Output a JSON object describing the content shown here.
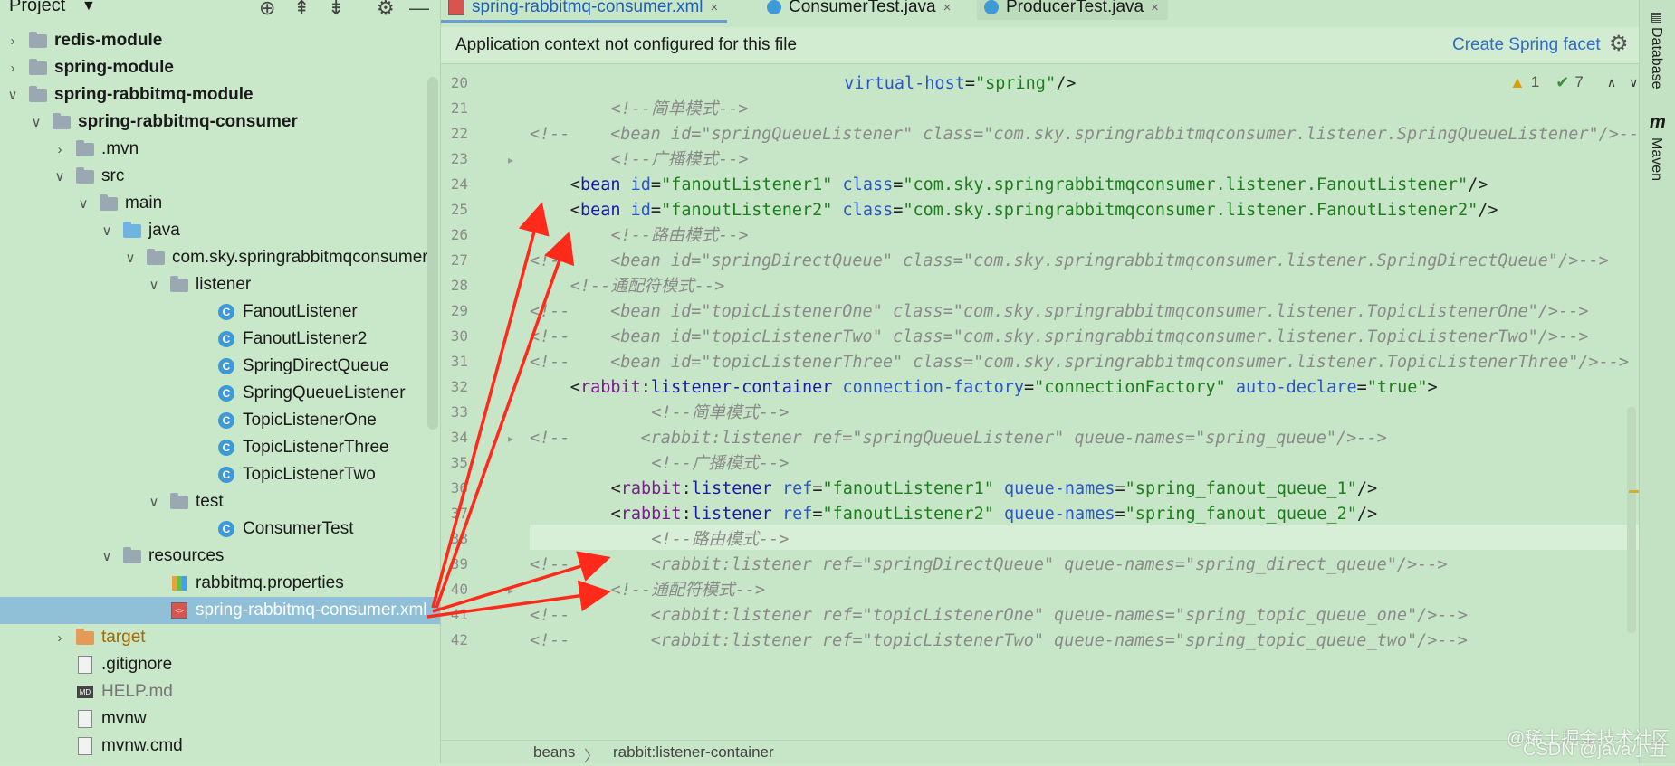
{
  "project_panel": {
    "title": "Project",
    "tree": [
      {
        "label": "redis-module",
        "bold": true,
        "icon": "module-folder",
        "chev": "right"
      },
      {
        "label": "spring-module",
        "bold": true,
        "icon": "module-folder",
        "chev": "right"
      },
      {
        "label": "spring-rabbitmq-module",
        "bold": true,
        "icon": "module-folder",
        "chev": "down"
      },
      {
        "label": "spring-rabbitmq-consumer",
        "bold": true,
        "icon": "module-folder",
        "chev": "down"
      },
      {
        "label": ".mvn",
        "icon": "folder",
        "chev": "right"
      },
      {
        "label": "src",
        "icon": "folder",
        "chev": "down"
      },
      {
        "label": "main",
        "icon": "folder",
        "chev": "down"
      },
      {
        "label": "java",
        "icon": "source-folder",
        "chev": "down"
      },
      {
        "label": "com.sky.springrabbitmqconsumer",
        "icon": "package",
        "chev": "down"
      },
      {
        "label": "listener",
        "icon": "package",
        "chev": "down"
      },
      {
        "label": "FanoutListener",
        "icon": "class"
      },
      {
        "label": "FanoutListener2",
        "icon": "class"
      },
      {
        "label": "SpringDirectQueue",
        "icon": "class"
      },
      {
        "label": "SpringQueueListener",
        "icon": "class"
      },
      {
        "label": "TopicListenerOne",
        "icon": "class"
      },
      {
        "label": "TopicListenerThree",
        "icon": "class"
      },
      {
        "label": "TopicListenerTwo",
        "icon": "class"
      },
      {
        "label": "test",
        "icon": "package",
        "chev": "down"
      },
      {
        "label": "ConsumerTest",
        "icon": "test-class"
      },
      {
        "label": "resources",
        "icon": "resources-folder",
        "chev": "down"
      },
      {
        "label": "rabbitmq.properties",
        "icon": "properties"
      },
      {
        "label": "spring-rabbitmq-consumer.xml",
        "icon": "xml",
        "selected": true
      },
      {
        "label": "target",
        "icon": "target-folder",
        "chev": "right"
      },
      {
        "label": ".gitignore",
        "icon": "file"
      },
      {
        "label": "HELP.md",
        "icon": "markdown"
      },
      {
        "label": "mvnw",
        "icon": "file"
      },
      {
        "label": "mvnw.cmd",
        "icon": "file"
      }
    ]
  },
  "tabs": [
    {
      "label": "spring-rabbitmq-consumer.xml",
      "active": true,
      "icon": "xml"
    },
    {
      "label": "ConsumerTest.java",
      "active": false,
      "icon": "class"
    },
    {
      "label": "ProducerTest.java",
      "active": false,
      "icon": "class"
    }
  ],
  "banner": {
    "text": "Application context not configured for this file",
    "action": "Create Spring facet"
  },
  "inspections": {
    "warnings": "1",
    "weak_warnings": "7"
  },
  "code_lines": [
    {
      "n": "20",
      "indent": 31,
      "parts": [
        [
          "at",
          "virtual-host"
        ],
        [
          "pl",
          "="
        ],
        [
          "st",
          "\"spring\""
        ],
        [
          "pl",
          "/>"
        ]
      ]
    },
    {
      "n": "21",
      "indent": 8,
      "parts": [
        [
          "cm",
          "<!--简单模式-->"
        ]
      ]
    },
    {
      "n": "22",
      "indent": 0,
      "parts": [
        [
          "cm",
          "<!--    <bean id=\"springQueueListener\" class=\"com.sky.springrabbitmqconsumer.listener.SpringQueueListener\"/>-->"
        ]
      ]
    },
    {
      "n": "23",
      "indent": 8,
      "parts": [
        [
          "cm",
          "<!--广播模式-->"
        ]
      ]
    },
    {
      "n": "24",
      "indent": 4,
      "parts": [
        [
          "pl",
          "<"
        ],
        [
          "tg",
          "bean "
        ],
        [
          "at",
          "id"
        ],
        [
          "pl",
          "="
        ],
        [
          "st",
          "\"fanoutListener1\" "
        ],
        [
          "at",
          "class"
        ],
        [
          "pl",
          "="
        ],
        [
          "st",
          "\"com.sky.springrabbitmqconsumer.listener.FanoutListener\""
        ],
        [
          "pl",
          "/>"
        ]
      ]
    },
    {
      "n": "25",
      "indent": 4,
      "parts": [
        [
          "pl",
          "<"
        ],
        [
          "tg",
          "bean "
        ],
        [
          "at",
          "id"
        ],
        [
          "pl",
          "="
        ],
        [
          "st",
          "\"fanoutListener2\" "
        ],
        [
          "at",
          "class"
        ],
        [
          "pl",
          "="
        ],
        [
          "st",
          "\"com.sky.springrabbitmqconsumer.listener.FanoutListener2\""
        ],
        [
          "pl",
          "/>"
        ]
      ]
    },
    {
      "n": "26",
      "indent": 8,
      "parts": [
        [
          "cm",
          "<!--路由模式-->"
        ]
      ]
    },
    {
      "n": "27",
      "indent": 0,
      "parts": [
        [
          "cm",
          "<!--    <bean id=\"springDirectQueue\" class=\"com.sky.springrabbitmqconsumer.listener.SpringDirectQueue\"/>-->"
        ]
      ]
    },
    {
      "n": "28",
      "indent": 4,
      "parts": [
        [
          "cm",
          "<!--通配符模式-->"
        ]
      ]
    },
    {
      "n": "29",
      "indent": 0,
      "parts": [
        [
          "cm",
          "<!--    <bean id=\"topicListenerOne\" class=\"com.sky.springrabbitmqconsumer.listener.TopicListenerOne\"/>-->"
        ]
      ]
    },
    {
      "n": "30",
      "indent": 0,
      "parts": [
        [
          "cm",
          "<!--    <bean id=\"topicListenerTwo\" class=\"com.sky.springrabbitmqconsumer.listener.TopicListenerTwo\"/>-->"
        ]
      ]
    },
    {
      "n": "31",
      "indent": 0,
      "parts": [
        [
          "cm",
          "<!--    <bean id=\"topicListenerThree\" class=\"com.sky.springrabbitmqconsumer.listener.TopicListenerThree\"/>-->"
        ]
      ]
    },
    {
      "n": "32",
      "indent": 4,
      "parts": [
        [
          "pl",
          "<"
        ],
        [
          "ns",
          "rabbit"
        ],
        [
          "pl",
          ":"
        ],
        [
          "tg",
          "listener-container "
        ],
        [
          "at",
          "connection-factory"
        ],
        [
          "pl",
          "="
        ],
        [
          "st",
          "\"connectionFactory\" "
        ],
        [
          "at",
          "auto-declare"
        ],
        [
          "pl",
          "="
        ],
        [
          "st",
          "\"true\""
        ],
        [
          "pl",
          ">"
        ]
      ]
    },
    {
      "n": "33",
      "indent": 12,
      "parts": [
        [
          "cm",
          "<!--简单模式-->"
        ]
      ]
    },
    {
      "n": "34",
      "indent": 0,
      "parts": [
        [
          "cm",
          "<!--       <rabbit:listener ref=\"springQueueListener\" queue-names=\"spring_queue\"/>-->"
        ]
      ]
    },
    {
      "n": "35",
      "indent": 12,
      "parts": [
        [
          "cm",
          "<!--广播模式-->"
        ]
      ]
    },
    {
      "n": "36",
      "indent": 8,
      "parts": [
        [
          "pl",
          "<"
        ],
        [
          "ns",
          "rabbit"
        ],
        [
          "pl",
          ":"
        ],
        [
          "tg",
          "listener "
        ],
        [
          "at",
          "ref"
        ],
        [
          "pl",
          "="
        ],
        [
          "st",
          "\"fanoutListener1\" "
        ],
        [
          "at",
          "queue-names"
        ],
        [
          "pl",
          "="
        ],
        [
          "st",
          "\"spring_fanout_queue_1\""
        ],
        [
          "pl",
          "/>"
        ]
      ]
    },
    {
      "n": "37",
      "indent": 8,
      "parts": [
        [
          "pl",
          "<"
        ],
        [
          "ns",
          "rabbit"
        ],
        [
          "pl",
          ":"
        ],
        [
          "tg",
          "listener "
        ],
        [
          "at",
          "ref"
        ],
        [
          "pl",
          "="
        ],
        [
          "st",
          "\"fanoutListener2\" "
        ],
        [
          "at",
          "queue-names"
        ],
        [
          "pl",
          "="
        ],
        [
          "st",
          "\"spring_fanout_queue_2\""
        ],
        [
          "pl",
          "/>"
        ]
      ]
    },
    {
      "n": "38",
      "indent": 12,
      "parts": [
        [
          "cm",
          "<!--路由模式-->"
        ]
      ]
    },
    {
      "n": "39",
      "indent": 0,
      "parts": [
        [
          "cm",
          "<!--        <rabbit:listener ref=\"springDirectQueue\" queue-names=\"spring_direct_queue\"/>-->"
        ]
      ]
    },
    {
      "n": "40",
      "indent": 8,
      "parts": [
        [
          "cm",
          "<!--通配符模式-->"
        ]
      ]
    },
    {
      "n": "41",
      "indent": 0,
      "parts": [
        [
          "cm",
          "<!--        <rabbit:listener ref=\"topicListenerOne\" queue-names=\"spring_topic_queue_one\"/>-->"
        ]
      ]
    },
    {
      "n": "42",
      "indent": 0,
      "parts": [
        [
          "cm",
          "<!--        <rabbit:listener ref=\"topicListenerTwo\" queue-names=\"spring_topic_queue_two\"/>-->"
        ]
      ]
    }
  ],
  "breadcrumb": {
    "first": "beans",
    "separator": "〉",
    "second": "rabbit:listener-container"
  },
  "right_strip": {
    "database": "Database",
    "maven": "Maven"
  },
  "watermark": {
    "line1": "@稀土掘金技术社区",
    "line2": "CSDN @java小丑"
  },
  "colors": {
    "accent": "#2f6cc4",
    "arrow": "#ff2a1a",
    "selection": "#8fc0d8"
  }
}
